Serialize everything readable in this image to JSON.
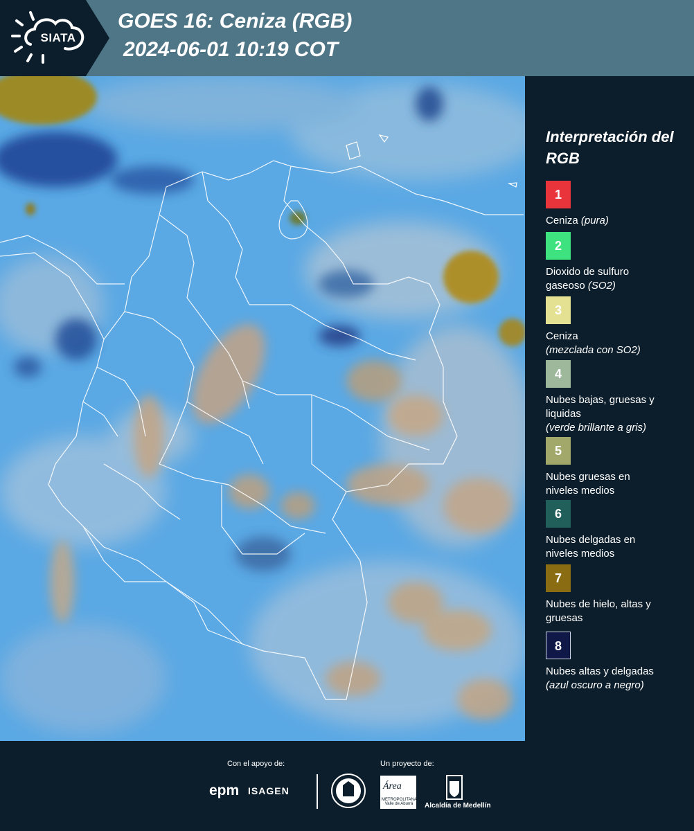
{
  "header": {
    "logo_text": "SIATA",
    "title": "GOES 16: Ceniza (RGB)",
    "datetime": "2024-06-01 10:19 COT",
    "colors": {
      "header_bg": "#4f7686",
      "logo_bg": "#0c1e2b"
    }
  },
  "map": {
    "icons": [
      "satellite-rgb-image",
      "country-boundaries",
      "department-boundaries"
    ],
    "colors": {
      "sky_blue": "#5aa8e4",
      "thin_cloud": "#8fb7d6",
      "ash_tan": "#c4a585",
      "ice_cloud": "#9c8a28",
      "dark_blue": "#1c3f93"
    }
  },
  "legend": {
    "title": "Interpretación del RGB",
    "items": [
      {
        "num": "1",
        "color": "#e8343a",
        "text": "Ceniza",
        "note": "(pura)"
      },
      {
        "num": "2",
        "color": "#3ee27f",
        "text": "Dioxido de sulfuro gaseoso",
        "note": "(SO2)"
      },
      {
        "num": "3",
        "color": "#e5e193",
        "text": "Ceniza",
        "note": "(mezclada con SO2)"
      },
      {
        "num": "4",
        "color": "#9db89b",
        "text": "Nubes bajas, gruesas y liquidas",
        "note": "(verde brillante a gris)"
      },
      {
        "num": "5",
        "color": "#a2a86a",
        "text": "Nubes gruesas en niveles medios",
        "note": ""
      },
      {
        "num": "6",
        "color": "#215f5a",
        "text": "Nubes delgadas en niveles medios",
        "note": ""
      },
      {
        "num": "7",
        "color": "#8a6d12",
        "text": "Nubes de hielo, altas y gruesas",
        "note": ""
      },
      {
        "num": "8",
        "color": "#101847",
        "text": "Nubes altas y delgadas",
        "note": "(azul oscuro a negro)"
      }
    ]
  },
  "footer": {
    "support_label": "Con el apoyo de:",
    "project_label": "Un proyecto de:",
    "epm": "epm",
    "isagen": "ISAGEN",
    "area_logo_text": "Área",
    "area_sub": "METROPOLITANA Valle de Aburrá",
    "medellin": "Alcaldía de Medellín"
  }
}
